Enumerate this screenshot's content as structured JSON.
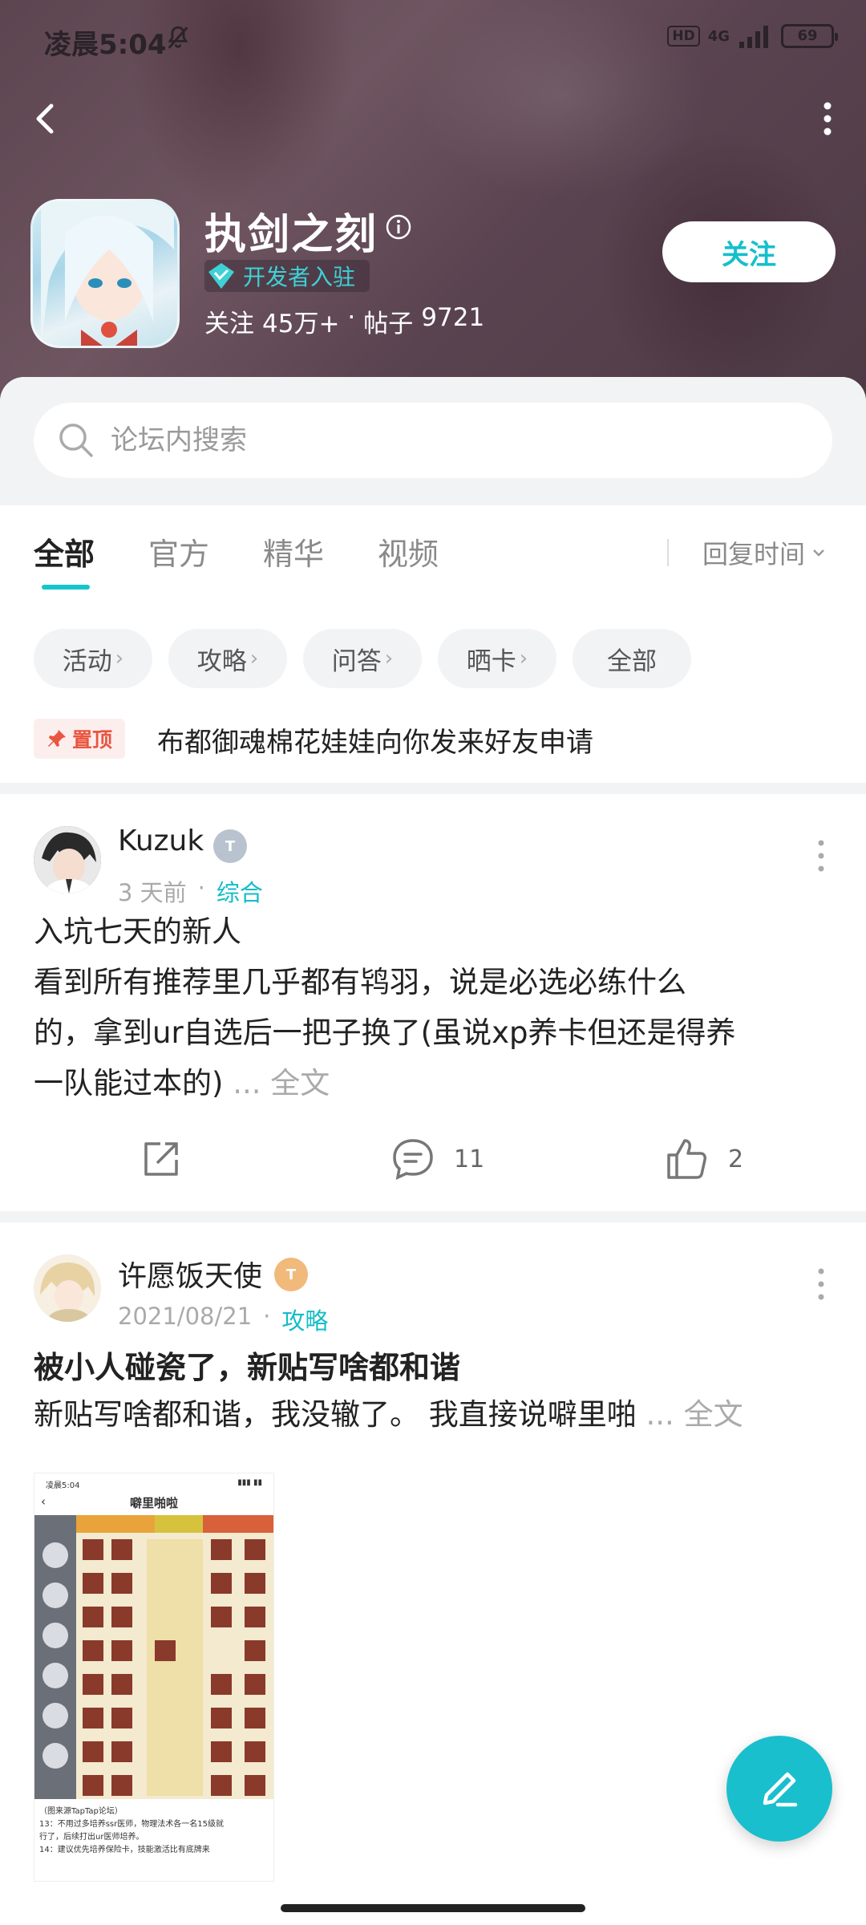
{
  "status_bar": {
    "time": "凌晨5:04",
    "hd": "HD",
    "network": "4G",
    "battery": "69"
  },
  "forum": {
    "title": "执剑之刻",
    "dev_badge": "开发者入驻",
    "followers_label": "关注",
    "followers": "45万+",
    "separator": "·",
    "posts_label": "帖子",
    "posts": "9721",
    "follow_button": "关注"
  },
  "search": {
    "placeholder": "论坛内搜索"
  },
  "tabs": [
    {
      "label": "全部",
      "active": true
    },
    {
      "label": "官方"
    },
    {
      "label": "精华"
    },
    {
      "label": "视频"
    }
  ],
  "sort": {
    "label": "回复时间"
  },
  "chips": [
    "活动",
    "攻略",
    "问答",
    "晒卡",
    "全部"
  ],
  "pinned": {
    "badge": "置顶",
    "text": "布都御魂棉花娃娃向你发来好友申请"
  },
  "posts": [
    {
      "author": "Kuzuk",
      "level": "T",
      "time": "3 天前",
      "dot": "·",
      "category": "综合",
      "lines": [
        "入坑七天的新人",
        "看到所有推荐里几乎都有鸨羽，说是必选必练什么",
        "的，拿到ur自选后一把子换了(虽说xp养卡但还是得养",
        "一队能过本的)"
      ],
      "more": "... 全文",
      "comments": "11",
      "likes": "2"
    },
    {
      "author": "许愿饭天使",
      "level": "T",
      "time": "2021/08/21",
      "dot": "·",
      "category": "攻略",
      "title": "被小人碰瓷了，新贴写啥都和谐",
      "summary": "新贴写啥都和谐，我没辙了。 我直接说噼里啪",
      "more": "... 全文",
      "image": {
        "time": "凌晨5:04",
        "title": "噼里啪啦",
        "caption_lines": [
          "（图来源TapTap论坛）",
          "13：不用过多培养ssr医师，物理法术各一名15级就",
          "行了，后续打出ur医师培养。",
          "14：建议优先培养保险卡，技能激活比有底牌来"
        ]
      }
    }
  ],
  "colors": {
    "accent": "#15c5ce",
    "pin": "#e9553f"
  }
}
